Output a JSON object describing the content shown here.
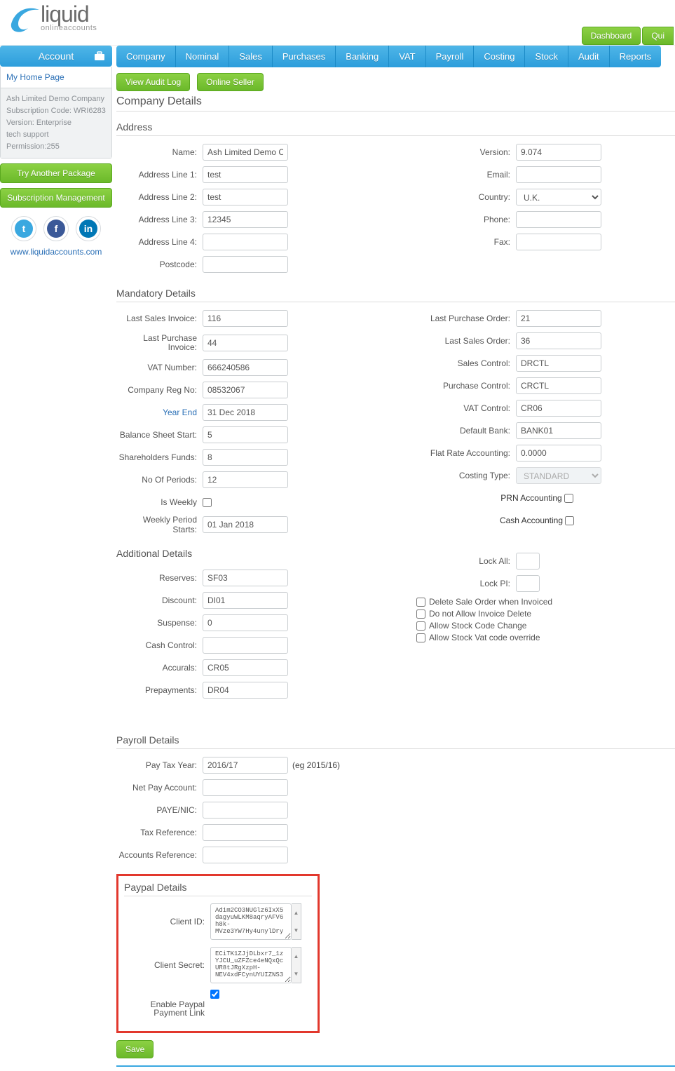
{
  "header": {
    "logo_main": "liquid",
    "logo_sub": "onlineaccounts",
    "dashboard": "Dashboard",
    "quick": "Qui"
  },
  "nav": {
    "account": "Account",
    "tabs": [
      "Company",
      "Nominal",
      "Sales",
      "Purchases",
      "Banking",
      "VAT",
      "Payroll",
      "Costing",
      "Stock",
      "Audit",
      "Reports"
    ]
  },
  "sidebar": {
    "home": "My Home Page",
    "company": "Ash Limited Demo Company",
    "sub_code_label": "Subscription Code:",
    "sub_code": "WRI6283",
    "version_label": "Version:",
    "version": "Enterprise",
    "support": "tech support",
    "perm_label": "Permission:",
    "perm": "255",
    "btn1": "Try Another Package",
    "btn2": "Subscription Management",
    "site": "www.liquidaccounts.com"
  },
  "actions": {
    "audit": "View Audit Log",
    "seller": "Online Seller"
  },
  "page_title": "Company Details",
  "address": {
    "title": "Address",
    "name_label": "Name:",
    "name": "Ash Limited Demo Company",
    "l1_label": "Address Line 1:",
    "l1": "test",
    "l2_label": "Address Line 2:",
    "l2": "test",
    "l3_label": "Address Line 3:",
    "l3": "12345",
    "l4_label": "Address Line 4:",
    "l4": "",
    "pc_label": "Postcode:",
    "pc": "",
    "ver_label": "Version:",
    "ver": "9.074",
    "email_label": "Email:",
    "email": "",
    "country_label": "Country:",
    "country": "U.K.",
    "phone_label": "Phone:",
    "phone": "",
    "fax_label": "Fax:",
    "fax": ""
  },
  "mandatory": {
    "title": "Mandatory Details",
    "lsi_label": "Last Sales Invoice:",
    "lsi": "116",
    "lpi_label": "Last Purchase Invoice:",
    "lpi": "44",
    "vat_label": "VAT Number:",
    "vat": "666240586",
    "reg_label": "Company Reg No:",
    "reg": "08532067",
    "ye_label": "Year End",
    "ye": "31 Dec 2018",
    "bss_label": "Balance Sheet Start:",
    "bss": "5",
    "shf_label": "Shareholders Funds:",
    "shf": "8",
    "nop_label": "No Of Periods:",
    "nop": "12",
    "iw_label": "Is Weekly",
    "wps_label": "Weekly Period Starts:",
    "wps": "01 Jan 2018",
    "lpo_label": "Last Purchase Order:",
    "lpo": "21",
    "lso_label": "Last Sales Order:",
    "lso": "36",
    "sc_label": "Sales Control:",
    "sc": "DRCTL",
    "pc_label": "Purchase Control:",
    "pc": "CRCTL",
    "vc_label": "VAT Control:",
    "vc": "CR06",
    "db_label": "Default Bank:",
    "db": "BANK01",
    "fra_label": "Flat Rate Accounting:",
    "fra": "0.0000",
    "ct_label": "Costing Type:",
    "ct": "STANDARD",
    "prn_label": "PRN Accounting",
    "cash_label": "Cash Accounting"
  },
  "additional": {
    "title": "Additional Details",
    "res_label": "Reserves:",
    "res": "SF03",
    "dis_label": "Discount:",
    "dis": "DI01",
    "sus_label": "Suspense:",
    "sus": "0",
    "cc_label": "Cash Control:",
    "cc": "",
    "acc_label": "Accurals:",
    "acc": "CR05",
    "pre_label": "Prepayments:",
    "pre": "DR04",
    "la_label": "Lock All:",
    "lpi_label": "Lock PI:",
    "opt1": "Delete Sale Order when Invoiced",
    "opt2": "Do not Allow Invoice Delete",
    "opt3": "Allow Stock Code Change",
    "opt4": "Allow Stock Vat code override"
  },
  "payroll": {
    "title": "Payroll Details",
    "pty_label": "Pay Tax Year:",
    "pty": "2016/17",
    "pty_hint": "(eg 2015/16)",
    "npa_label": "Net Pay Account:",
    "paye_label": "PAYE/NIC:",
    "tr_label": "Tax Reference:",
    "ar_label": "Accounts Reference:"
  },
  "paypal": {
    "title": "Paypal Details",
    "cid_label": "Client ID:",
    "cid": "Adim2CO3NUGlz6IxX5dagyuWLKM8aqryAFV6h8k-MVze3YW7Hy4unylDry",
    "cs_label": "Client Secret:",
    "cs": "ECiTK1ZJjDLbxr7_1zYJCU_uZFZce4eNQxQcUR8tJRgXzpH-NEV4xdFCynUYUIZNS3",
    "epl_label": "Enable Paypal Payment Link"
  },
  "save": "Save"
}
